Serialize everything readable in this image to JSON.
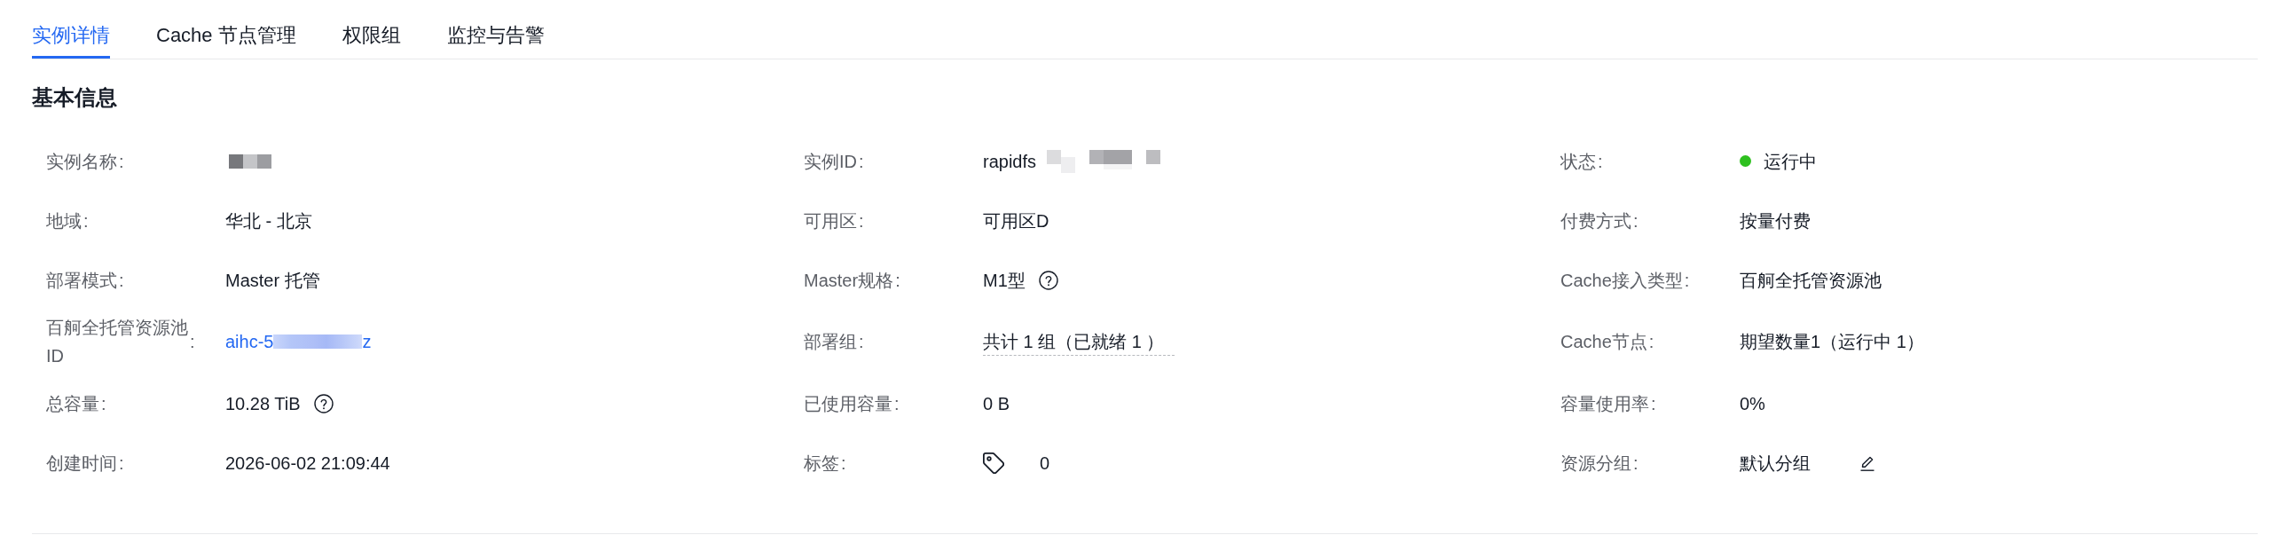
{
  "tabs": [
    {
      "label": "实例详情",
      "selected": true
    },
    {
      "label": "Cache 节点管理",
      "selected": false
    },
    {
      "label": "权限组",
      "selected": false
    },
    {
      "label": "监控与告警",
      "selected": false
    }
  ],
  "section": {
    "title": "基本信息"
  },
  "fields": [
    {
      "label": "实例名称",
      "colon": ":",
      "kind": "redacted"
    },
    {
      "label": "实例ID",
      "colon": ":",
      "kind": "partly_redacted",
      "value": "rapidfs"
    },
    {
      "label": "状态",
      "colon": ":",
      "kind": "status",
      "value": "运行中",
      "color": "#2ec01f"
    },
    {
      "label": "地域",
      "colon": ":",
      "kind": "text",
      "value": "华北 - 北京"
    },
    {
      "label": "可用区",
      "colon": ":",
      "kind": "text",
      "value": "可用区D"
    },
    {
      "label": "付费方式",
      "colon": ":",
      "kind": "text",
      "value": "按量付费"
    },
    {
      "label": "部署模式",
      "colon": ":",
      "kind": "text",
      "value": "Master 托管"
    },
    {
      "label": "Master规格",
      "colon": ":",
      "kind": "help",
      "value": "M1型"
    },
    {
      "label": "Cache接入类型",
      "colon": ":",
      "kind": "text",
      "value": "百舸全托管资源池"
    },
    {
      "label": "百舸全托管资源池ID",
      "colon": ":",
      "kind": "link",
      "value": "aihc-5",
      "value_end": "z"
    },
    {
      "label": "部署组",
      "colon": ":",
      "kind": "tooltip",
      "value": "共计 1 组（已就绪 1 ）"
    },
    {
      "label": "Cache节点",
      "colon": ":",
      "kind": "text",
      "value": "期望数量1（运行中 1）"
    },
    {
      "label": "总容量",
      "colon": ":",
      "kind": "help",
      "value": "10.28 TiB"
    },
    {
      "label": "已使用容量",
      "colon": ":",
      "kind": "text",
      "value": "0 B"
    },
    {
      "label": "容量使用率",
      "colon": ":",
      "kind": "text",
      "value": "0%"
    },
    {
      "label": "创建时间",
      "colon": ":",
      "kind": "text",
      "value": "2026-06-02 21:09:44"
    },
    {
      "label": "标签",
      "colon": ":",
      "kind": "tags",
      "value": "0"
    },
    {
      "label": "资源分组",
      "colon": ":",
      "kind": "editable",
      "value": "默认分组"
    }
  ]
}
